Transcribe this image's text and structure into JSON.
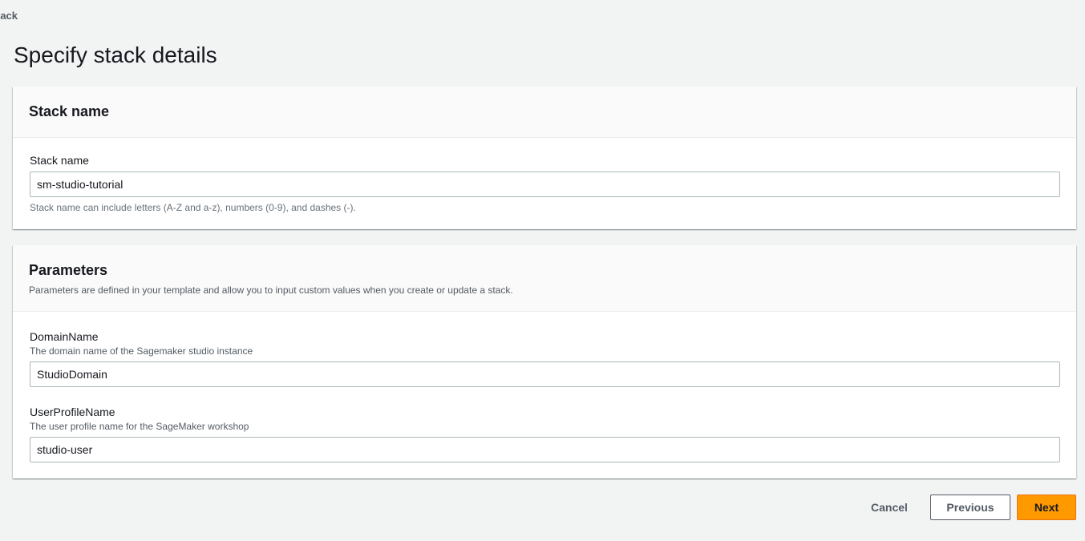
{
  "breadcrumb": {
    "label": "tack"
  },
  "page": {
    "title": "Specify stack details"
  },
  "stack_section": {
    "header": "Stack name",
    "field_label": "Stack name",
    "field_value": "sm-studio-tutorial",
    "constraint": "Stack name can include letters (A-Z and a-z), numbers (0-9), and dashes (-)."
  },
  "parameters_section": {
    "header": "Parameters",
    "description": "Parameters are defined in your template and allow you to input custom values when you create or update a stack.",
    "fields": [
      {
        "label": "DomainName",
        "description": "The domain name of the Sagemaker studio instance",
        "value": "StudioDomain"
      },
      {
        "label": "UserProfileName",
        "description": "The user profile name for the SageMaker workshop",
        "value": "studio-user"
      }
    ]
  },
  "actions": {
    "cancel": "Cancel",
    "previous": "Previous",
    "next": "Next"
  },
  "colors": {
    "background": "#f2f3f3",
    "primary_button": "#ff9900",
    "text": "#16191f",
    "secondary_text": "#545b64"
  }
}
